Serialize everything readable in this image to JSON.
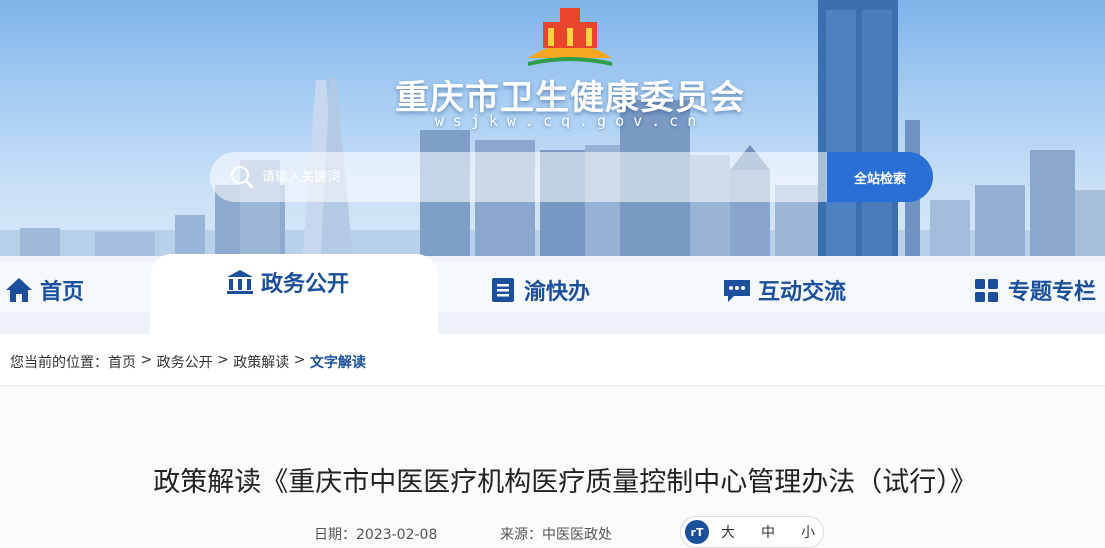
{
  "header": {
    "site_title": "重庆市卫生健康委员会",
    "site_domain": "wsjkw.cq.gov.cn",
    "logo_icon": "government-building-logo"
  },
  "search": {
    "placeholder": "请输入关键词",
    "button_label": "全站检索"
  },
  "nav": {
    "items": [
      {
        "label": "首页",
        "icon": "home-icon"
      },
      {
        "label": "政务公开",
        "icon": "building-icon",
        "active": true
      },
      {
        "label": "渝快办",
        "icon": "checklist-icon"
      },
      {
        "label": "互动交流",
        "icon": "chat-icon"
      },
      {
        "label": "专题专栏",
        "icon": "grid-icon"
      }
    ]
  },
  "breadcrumb": {
    "prefix": "您当前的位置：",
    "items": [
      "首页",
      "政务公开",
      "政策解读",
      "文字解读"
    ],
    "separator": " > "
  },
  "article": {
    "title": "政策解读《重庆市中医医疗机构医疗质量控制中心管理办法（试行）》",
    "date": "日期：2023-02-08",
    "source": "来源：中医医政处"
  },
  "font_size": {
    "icon_text": "rT",
    "options": [
      "大",
      "中",
      "小"
    ]
  },
  "colors": {
    "primary_blue": "#1b4f9c",
    "button_blue": "#2a6fd6"
  }
}
